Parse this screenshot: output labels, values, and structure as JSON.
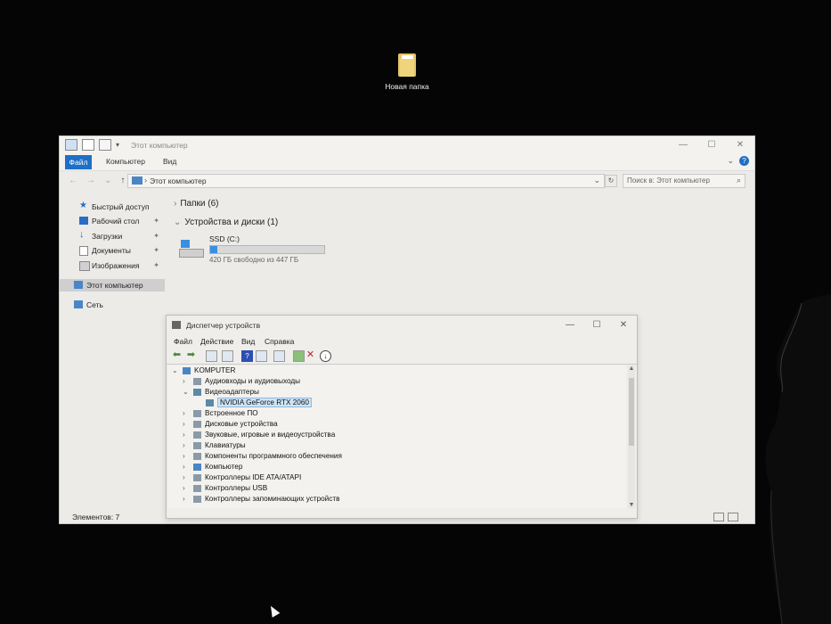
{
  "desktop": {
    "folder_label": "Новая папка"
  },
  "explorer": {
    "title": "Этот компьютер",
    "ribbon_tabs": [
      "Файл",
      "Компьютер",
      "Вид"
    ],
    "address": "Этот компьютер",
    "search_placeholder": "Поиск в: Этот компьютер",
    "sidebar": [
      {
        "label": "Быстрый доступ",
        "icon": "star-icon",
        "pinned": false
      },
      {
        "label": "Рабочий стол",
        "icon": "desktop-icon",
        "pinned": true
      },
      {
        "label": "Загрузки",
        "icon": "download-icon",
        "pinned": true
      },
      {
        "label": "Документы",
        "icon": "document-icon",
        "pinned": true
      },
      {
        "label": "Изображения",
        "icon": "image-icon",
        "pinned": true
      },
      {
        "label": "Этот компьютер",
        "icon": "computer-icon",
        "pinned": false,
        "selected": true
      },
      {
        "label": "Сеть",
        "icon": "network-icon",
        "pinned": false
      }
    ],
    "groups": {
      "folders": "Папки (6)",
      "devices": "Устройства и диски (1)"
    },
    "drive": {
      "name": "SSD (C:)",
      "free_text": "420 ГБ свободно из 447 ГБ",
      "used_fraction": 0.06
    },
    "status": "Элементов: 7",
    "accent": "#1e6fc6"
  },
  "device_manager": {
    "title": "Диспетчер устройств",
    "menu": [
      "Файл",
      "Действие",
      "Вид",
      "Справка"
    ],
    "tree": [
      {
        "label": "KOMPUTER",
        "level": 0,
        "expanded": true
      },
      {
        "label": "Аудиовходы и аудиовыходы",
        "level": 1,
        "expanded": false
      },
      {
        "label": "Видеоадаптеры",
        "level": 1,
        "expanded": true
      },
      {
        "label": "NVIDIA GeForce RTX 2060",
        "level": 2,
        "selected": true
      },
      {
        "label": "Встроенное ПО",
        "level": 1,
        "expanded": false
      },
      {
        "label": "Дисковые устройства",
        "level": 1,
        "expanded": false
      },
      {
        "label": "Звуковые, игровые и видеоустройства",
        "level": 1,
        "expanded": false
      },
      {
        "label": "Клавиатуры",
        "level": 1,
        "expanded": false
      },
      {
        "label": "Компоненты программного обеспечения",
        "level": 1,
        "expanded": false
      },
      {
        "label": "Компьютер",
        "level": 1,
        "expanded": false
      },
      {
        "label": "Контроллеры IDE ATA/ATAPI",
        "level": 1,
        "expanded": false
      },
      {
        "label": "Контроллеры USB",
        "level": 1,
        "expanded": false
      },
      {
        "label": "Контроллеры запоминающих устройств",
        "level": 1,
        "expanded": false
      }
    ]
  }
}
